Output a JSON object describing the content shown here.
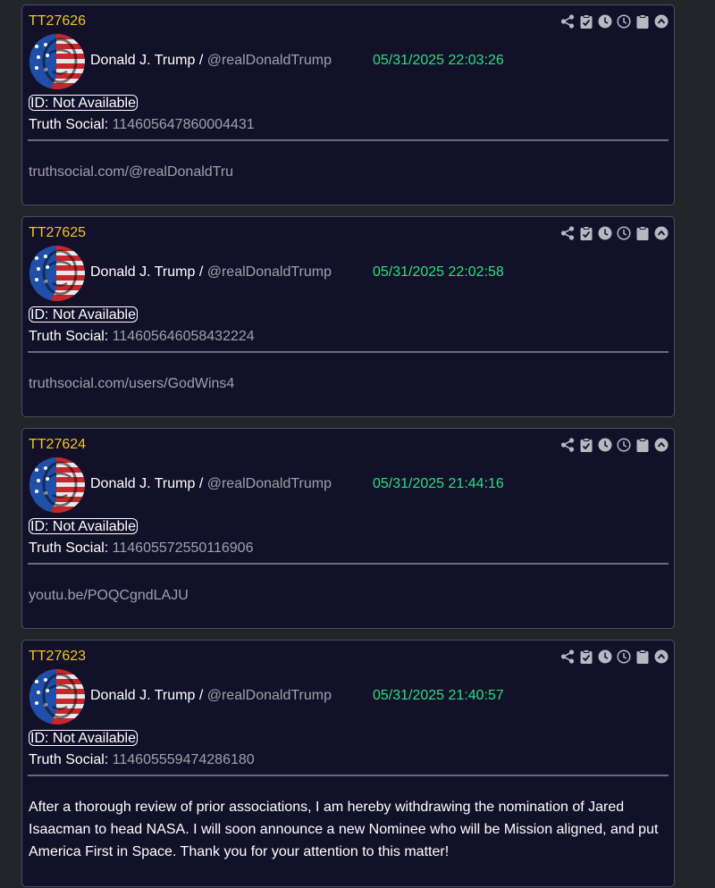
{
  "posts": [
    {
      "id": "TT27626",
      "author_name": "Donald J. Trump / ",
      "handle": "@realDonaldTrump",
      "timestamp": "05/31/2025 22:03:26",
      "id_badge": "ID: Not Available",
      "truth_label": "Truth Social: ",
      "truth_id": "114605647860004431",
      "content": "truthsocial.com/@realDonaldTru"
    },
    {
      "id": "TT27625",
      "author_name": "Donald J. Trump / ",
      "handle": "@realDonaldTrump",
      "timestamp": "05/31/2025 22:02:58",
      "id_badge": "ID: Not Available",
      "truth_label": "Truth Social: ",
      "truth_id": "114605646058432224",
      "content": "truthsocial.com/users/GodWins4"
    },
    {
      "id": "TT27624",
      "author_name": "Donald J. Trump / ",
      "handle": "@realDonaldTrump",
      "timestamp": "05/31/2025 21:44:16",
      "id_badge": "ID: Not Available",
      "truth_label": "Truth Social: ",
      "truth_id": "114605572550116906",
      "content": "youtu.be/POQCgndLAJU"
    },
    {
      "id": "TT27623",
      "author_name": "Donald J. Trump / ",
      "handle": "@realDonaldTrump",
      "timestamp": "05/31/2025 21:40:57",
      "id_badge": "ID: Not Available",
      "truth_label": "Truth Social: ",
      "truth_id": "114605559474286180",
      "content": "After a thorough review of prior associations, I am hereby withdrawing the nomination of Jared Isaacman to head NASA. I will soon announce a new Nominee who will be Mission aligned, and put America First in Space. Thank you for your attention to this matter!"
    }
  ],
  "toolbar_icons": [
    "share-icon",
    "clipboard-check-icon",
    "clock-filled-icon",
    "clock-outline-icon",
    "clipboard-icon",
    "caret-up-circle-icon"
  ],
  "colors": {
    "background": "#212529",
    "card": "#13112a",
    "post_id": "#f3c51c",
    "timestamp": "#26e07d",
    "muted": "#a0a0a8"
  }
}
